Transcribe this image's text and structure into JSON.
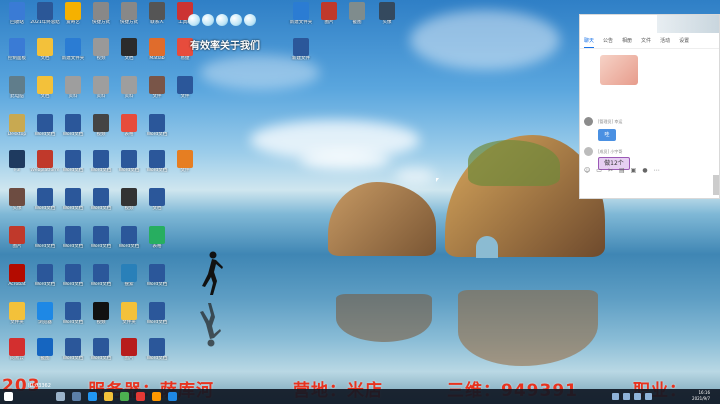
{
  "desktop": {
    "top_banner_title": "有效率关于我们",
    "icons": [
      {
        "label": "回收站",
        "color": "#3a7bd5"
      },
      {
        "label": "2021年终总结",
        "color": "#2b5797"
      },
      {
        "label": "爱奇艺",
        "color": "#f6b100"
      },
      {
        "label": "快捷方式",
        "color": "#888888"
      },
      {
        "label": "快捷方式",
        "color": "#888888"
      },
      {
        "label": "联系人",
        "color": "#555555"
      },
      {
        "label": "工具箱",
        "color": "#cc3333"
      },
      {
        "label": "新建文件夹",
        "color": "#2b7cd3"
      },
      {
        "label": "图片",
        "color": "#c0392b"
      },
      {
        "label": "截图",
        "color": "#7f8c8d"
      },
      {
        "label": "头像",
        "color": "#34495e"
      },
      {
        "label": "控制面板",
        "color": "#3a7bd5"
      },
      {
        "label": "文档",
        "color": "#f3c13a"
      },
      {
        "label": "新建文件夹",
        "color": "#2b7cd3"
      },
      {
        "label": "视频",
        "color": "#999999"
      },
      {
        "label": "文档",
        "color": "#2b2b2b"
      },
      {
        "label": "Matlab",
        "color": "#e06c2c"
      },
      {
        "label": "易捷",
        "color": "#e74c3c"
      },
      {
        "label": "新建文件",
        "color": "#2b579a"
      },
      {
        "label": "此电脑",
        "color": "#607d8b"
      },
      {
        "label": "文档",
        "color": "#f3c13a"
      },
      {
        "label": "资料",
        "color": "#9e9e9e"
      },
      {
        "label": "资料",
        "color": "#9e9e9e"
      },
      {
        "label": "资料",
        "color": "#9e9e9e"
      },
      {
        "label": "文件",
        "color": "#795548"
      },
      {
        "label": "文件",
        "color": "#2b579a"
      },
      {
        "label": "Desktop",
        "color": "#c8a951"
      },
      {
        "label": "Word文档",
        "color": "#2b579a"
      },
      {
        "label": "Word文档",
        "color": "#2b579a"
      },
      {
        "label": "视频",
        "color": "#444444"
      },
      {
        "label": "表格",
        "color": "#e74c3c"
      },
      {
        "label": "Word文档",
        "color": "#2b579a"
      },
      {
        "label": "F3",
        "color": "#1e3a5f"
      },
      {
        "label": "Webplatform",
        "color": "#c0392b"
      },
      {
        "label": "Word文档",
        "color": "#2b579a"
      },
      {
        "label": "Word文档",
        "color": "#2b579a"
      },
      {
        "label": "Word文档",
        "color": "#2b579a"
      },
      {
        "label": "Word文档",
        "color": "#2b579a"
      },
      {
        "label": "文件",
        "color": "#e67e22"
      },
      {
        "label": "头像",
        "color": "#6d4c41"
      },
      {
        "label": "Word文档",
        "color": "#2b579a"
      },
      {
        "label": "Word文档",
        "color": "#2b579a"
      },
      {
        "label": "Word文档",
        "color": "#2b579a"
      },
      {
        "label": "视频",
        "color": "#333333"
      },
      {
        "label": "文档",
        "color": "#2b579a"
      },
      {
        "label": "图片",
        "color": "#c0392b"
      },
      {
        "label": "Word文档",
        "color": "#2b579a"
      },
      {
        "label": "Word文档",
        "color": "#2b579a"
      },
      {
        "label": "Word文档",
        "color": "#2b579a"
      },
      {
        "label": "Word文档",
        "color": "#2b579a"
      },
      {
        "label": "表格",
        "color": "#27ae60"
      },
      {
        "label": "Acrobat",
        "color": "#b30b00"
      },
      {
        "label": "Word文档",
        "color": "#2b579a"
      },
      {
        "label": "Word文档",
        "color": "#2b579a"
      },
      {
        "label": "Word文档",
        "color": "#2b579a"
      },
      {
        "label": "搜索",
        "color": "#2980b9"
      },
      {
        "label": "Word文档",
        "color": "#2b579a"
      },
      {
        "label": "文件夹",
        "color": "#f3c13a"
      },
      {
        "label": "浏览器",
        "color": "#1e88e5"
      },
      {
        "label": "Word文档",
        "color": "#2b579a"
      },
      {
        "label": "视频",
        "color": "#111111"
      },
      {
        "label": "文件夹",
        "color": "#f3c13a"
      },
      {
        "label": "Word文档",
        "color": "#2b579a"
      },
      {
        "label": "网易云",
        "color": "#d32f2f"
      },
      {
        "label": "截图",
        "color": "#1565c0"
      },
      {
        "label": "Word文档",
        "color": "#2b579a"
      },
      {
        "label": "Word文档",
        "color": "#2b579a"
      },
      {
        "label": "图片",
        "color": "#b71c1c"
      },
      {
        "label": "Word文档",
        "color": "#2b579a"
      }
    ]
  },
  "chat": {
    "tabs": [
      "聊天",
      "公告",
      "相册",
      "文件",
      "活动",
      "设置"
    ],
    "sender1": "[管理员] 幸运",
    "msg1": "哇",
    "sender2": "[成员] 小宇哥",
    "msg2": "做12个"
  },
  "banner": {
    "part1": "203",
    "part2": "服务器：萨库河",
    "part3": "营地：米店",
    "part4": "三维：949391",
    "part5": "职业：",
    "id_text": "ID:03362"
  },
  "taskbar": {
    "time": "16:16",
    "date": "2021/9/7"
  }
}
